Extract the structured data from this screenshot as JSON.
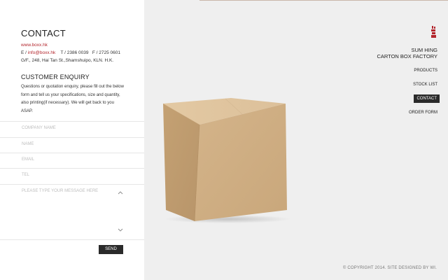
{
  "contact": {
    "title": "CONTACT",
    "website": "www.boxx.hk",
    "email_prefix": "E / ",
    "email": "info@boxx.hk",
    "tel": "T / 2386 0039",
    "fax": "F / 2725 0601",
    "address": "G/F., 248, Hai Tan St.,Shamshuipo, KLN. H.K."
  },
  "enquiry": {
    "title": "CUSTOMER ENQUIRY",
    "text": "Questions or quotation enquiry, please fill out the below form and tell us your specifications, size and quantity, also printing(if necessary). We will get back to you ASAP."
  },
  "form": {
    "company_placeholder": "COMPANY NAME",
    "name_placeholder": "NAME",
    "email_placeholder": "EMAIL",
    "tel_placeholder": "TEL",
    "message_placeholder": "PLEASE TYPE YOUR MESSAGE HERE",
    "send_label": "SEND"
  },
  "brand": {
    "line1": "SUM HING",
    "line2": "CARTON BOX FACTORY",
    "accent": "#b3262d"
  },
  "nav": {
    "items": [
      "PRODUCTS",
      "STOCK LIST",
      "CONTACT",
      "ORDER FORM"
    ],
    "active": "CONTACT"
  },
  "footer": {
    "copyright": "© COPYRIGHT 2014. SITE DESIGNED BY WI."
  }
}
